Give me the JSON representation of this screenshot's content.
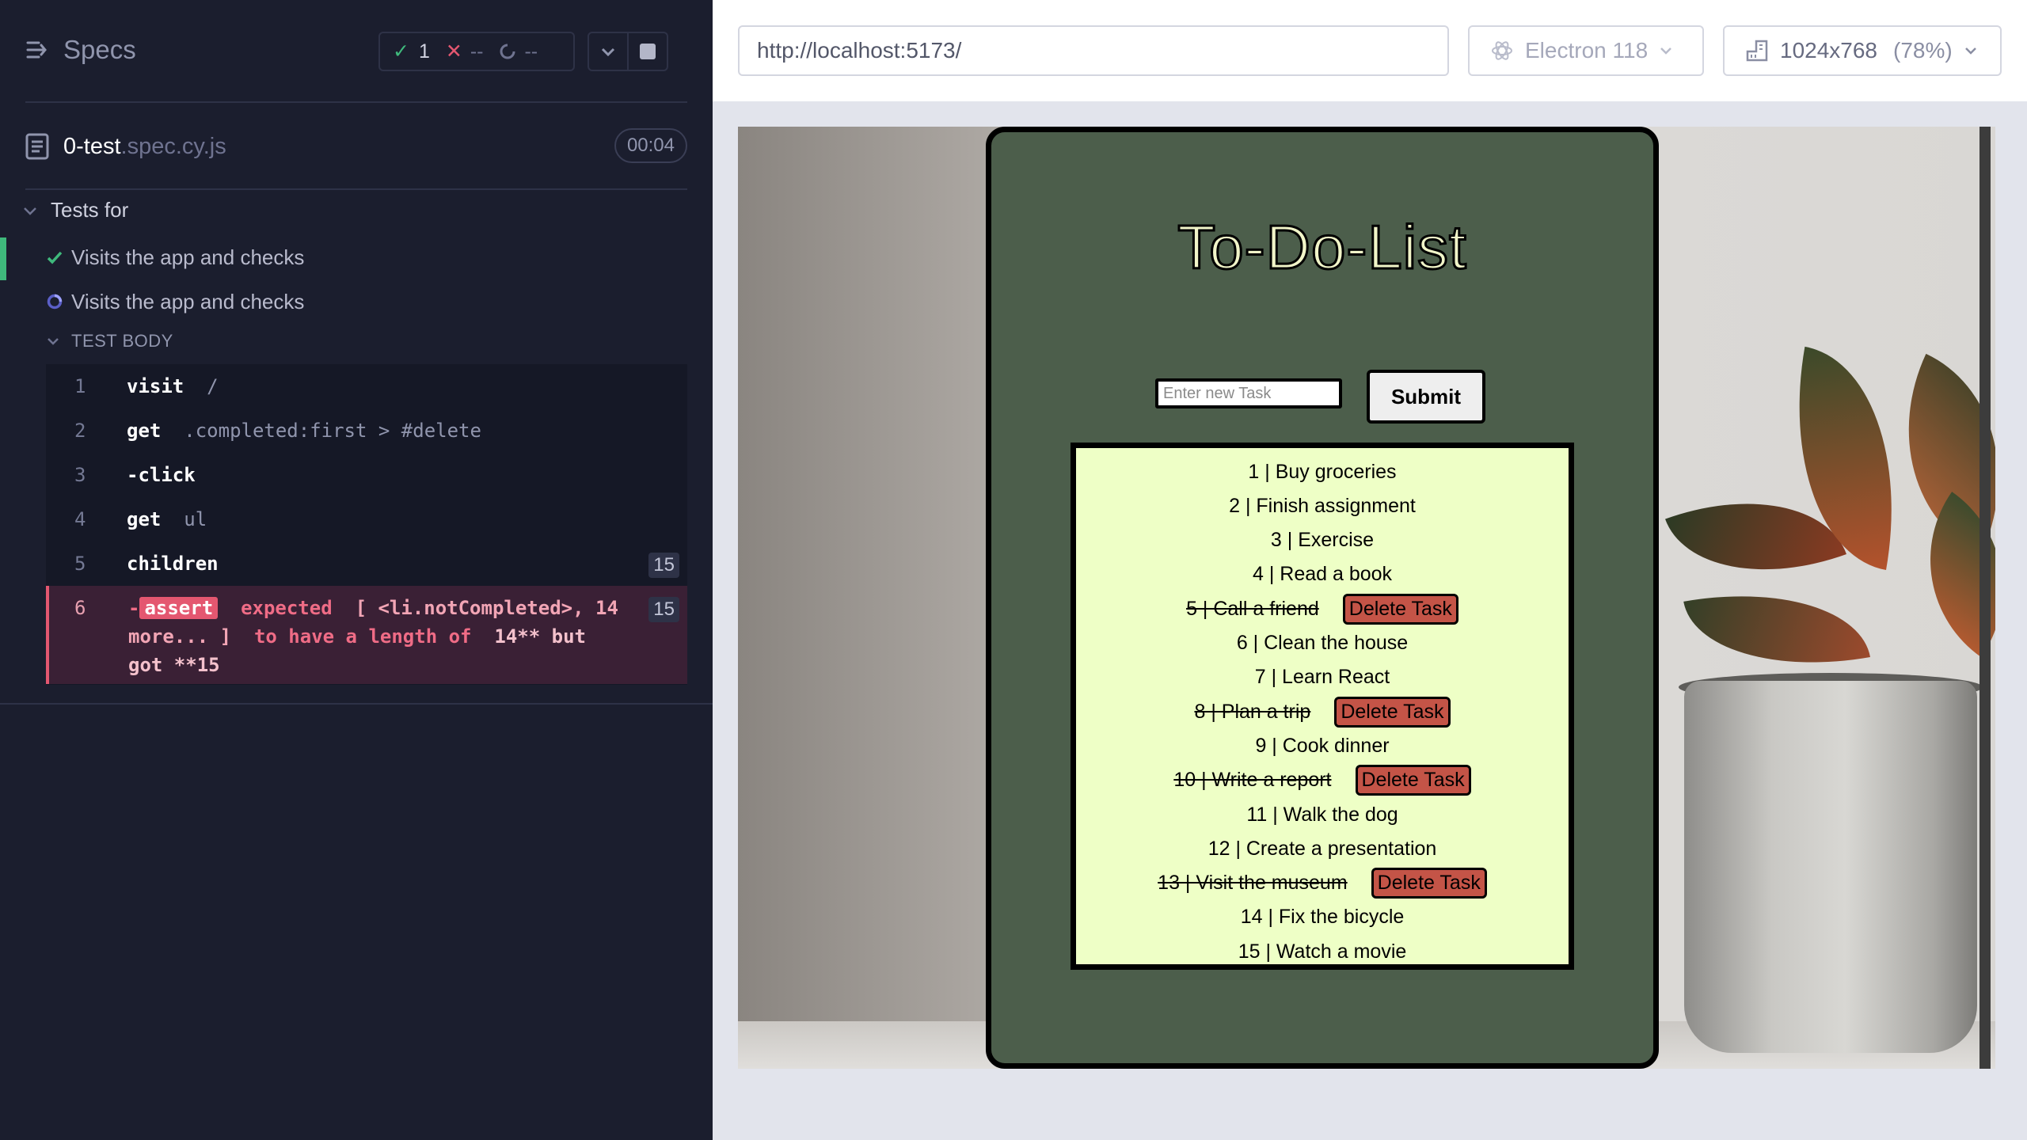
{
  "reporter": {
    "title": "Specs",
    "stats": {
      "passed": "1",
      "failed": "--",
      "pending": "--"
    },
    "spec": {
      "name": "0-test",
      "ext": ".spec.cy.js",
      "duration": "00:04"
    },
    "suite": "Tests for",
    "tests": [
      {
        "label": "Visits the app and checks",
        "state": "passed"
      },
      {
        "label": "Visits the app and checks",
        "state": "running"
      }
    ],
    "body_label": "TEST BODY",
    "commands": [
      {
        "num": "1",
        "name": "visit",
        "arg": "/",
        "badge": ""
      },
      {
        "num": "2",
        "name": "get",
        "arg": ".completed:first > #delete",
        "badge": ""
      },
      {
        "num": "3",
        "name": "-click",
        "arg": "",
        "badge": ""
      },
      {
        "num": "4",
        "name": "get",
        "arg": "ul",
        "badge": ""
      },
      {
        "num": "5",
        "name": "children",
        "arg": "",
        "badge": "15"
      }
    ],
    "error_command": {
      "num": "6",
      "dash": "-",
      "tag": "assert",
      "expected": "expected",
      "list": "[ <li.notCompleted>, 14 more... ]",
      "to_have": "to have a length of",
      "value": "14** but got **15",
      "badge": "15"
    }
  },
  "aut": {
    "url": "http://localhost:5173/",
    "browser": "Electron 118",
    "viewport": "1024x768",
    "zoom": "(78%)"
  },
  "todo": {
    "title": "To-Do-List",
    "input_placeholder": "Enter new Task",
    "submit_label": "Submit",
    "delete_label": "Delete Task",
    "items": [
      {
        "text": "1 | Buy groceries",
        "completed": false
      },
      {
        "text": "2 | Finish assignment",
        "completed": false
      },
      {
        "text": "3 | Exercise",
        "completed": false
      },
      {
        "text": "4 | Read a book",
        "completed": false
      },
      {
        "text": "5 | Call a friend ",
        "completed": true
      },
      {
        "text": "6 | Clean the house",
        "completed": false
      },
      {
        "text": "7 | Learn React",
        "completed": false
      },
      {
        "text": "8 | Plan a trip ",
        "completed": true
      },
      {
        "text": "9 | Cook dinner",
        "completed": false
      },
      {
        "text": "10 | Write a report ",
        "completed": true
      },
      {
        "text": "11 | Walk the dog",
        "completed": false
      },
      {
        "text": "12 | Create a presentation",
        "completed": false
      },
      {
        "text": "13 | Visit the museum ",
        "completed": true
      },
      {
        "text": "14 | Fix the bicycle",
        "completed": false
      },
      {
        "text": "15 | Watch a movie",
        "completed": false
      }
    ]
  },
  "colors": {
    "pass": "#3fb97c",
    "fail": "#e45770",
    "card_bg": "#4c5e4b",
    "list_bg": "#eeffc6",
    "delete_bg": "#c45447"
  }
}
